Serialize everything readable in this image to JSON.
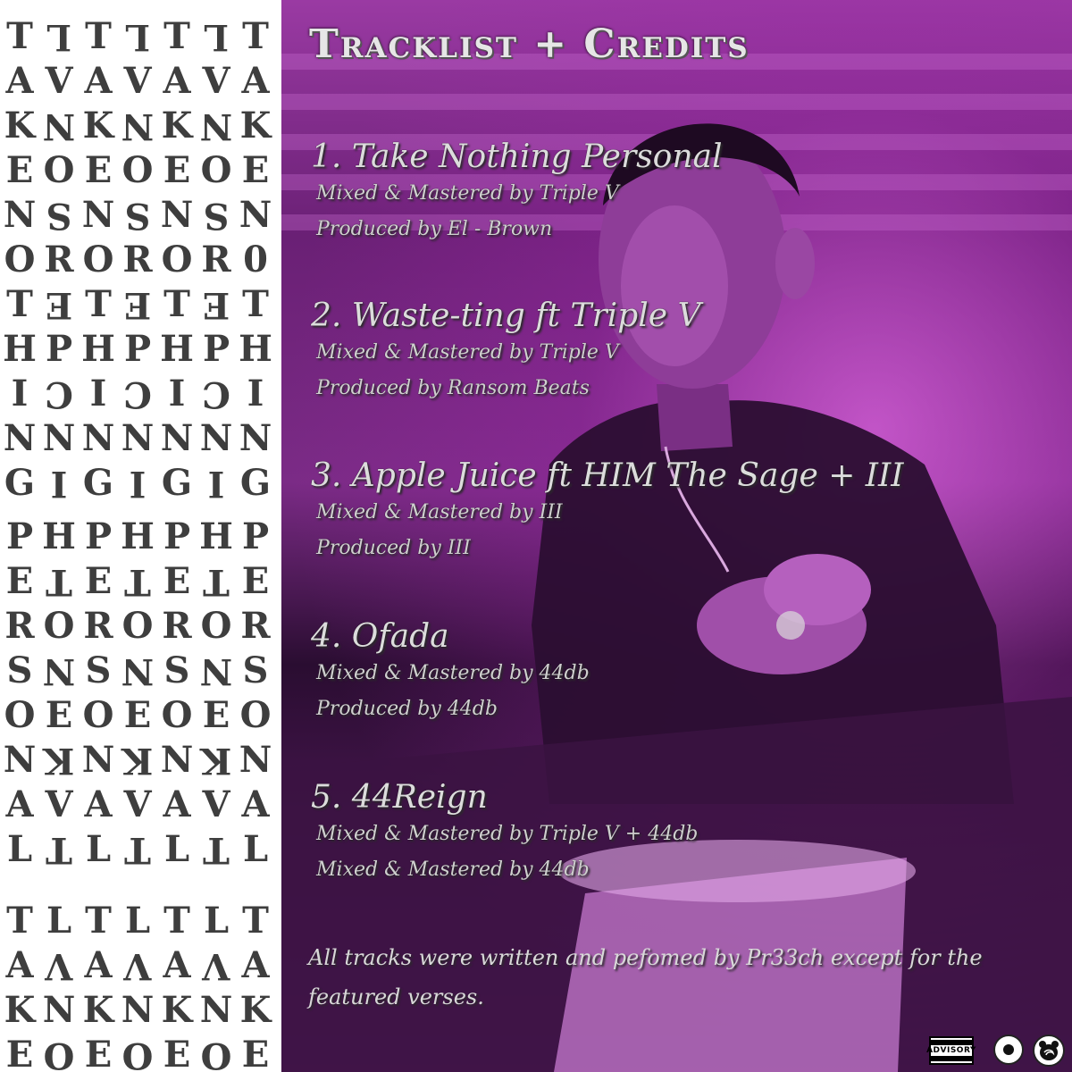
{
  "side_panel": {
    "rows": [
      "TLTLTLT",
      "AVAVAVA",
      "KNKNKNK",
      "EOEOEOE",
      "NSNSNSN",
      "OROROR0",
      "TETETET",
      "HPHPHPH",
      "ICICICI",
      "NNNNNNN",
      "GIGIGIG",
      "PHPHPHP",
      "ETETETE",
      "RORORO R",
      "SNSNSNS",
      "OEOEOEO",
      "NKNKNKN",
      "AVAVAVA",
      "LTLTLTL",
      "TLTLTLT",
      "AVAVAVA",
      "KNKNKNK",
      "EOEOEOE"
    ]
  },
  "header": {
    "title": "Tracklist + Credits"
  },
  "tracks": [
    {
      "title": "1. Take Nothing Personal",
      "credits": [
        "Mixed & Mastered by Triple V",
        "Produced by El - Brown"
      ]
    },
    {
      "title": "2. Waste-ting ft Triple V",
      "credits": [
        "Mixed & Mastered by Triple V",
        "Produced by Ransom Beats"
      ]
    },
    {
      "title": "3. Apple Juice ft HIM The Sage + III",
      "credits": [
        "Mixed & Mastered by III",
        "Produced by III"
      ]
    },
    {
      "title": "4. Ofada",
      "credits": [
        "Mixed & Mastered by 44db",
        "Produced by 44db"
      ]
    },
    {
      "title": "5. 44Reign",
      "credits": [
        "Mixed & Mastered by Triple V + 44db",
        "Mixed & Mastered by 44db"
      ]
    }
  ],
  "footnote": "All tracks were written and pefomed by Pr33ch except for the featured verses.",
  "badges": {
    "advisory_top": "PARENTAL",
    "advisory_mid": "ADVISORY",
    "advisory_bottom": "EXPLICIT CONTENT"
  },
  "colors": {
    "accent": "#b03fbf",
    "text": "#dcdcdc",
    "panel_text": "#3e3e3e"
  },
  "icons": [
    "record-logo-icon",
    "bear-logo-icon"
  ]
}
